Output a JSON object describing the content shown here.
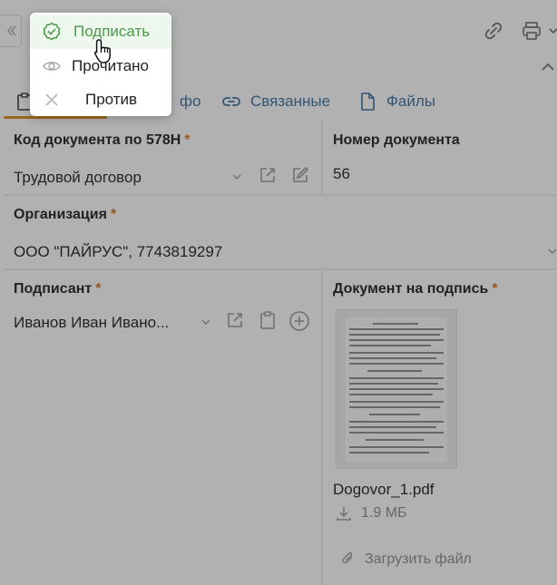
{
  "menu": {
    "items": [
      {
        "label": "Подписать",
        "icon": "check-circle-icon",
        "color": "#4a9a4a"
      },
      {
        "label": "Прочитано",
        "icon": "eye-icon",
        "color": "#222222"
      },
      {
        "label": "Против",
        "icon": "close-icon",
        "color": "#222222"
      }
    ]
  },
  "tabs": [
    {
      "label": "фо",
      "icon": "clipboard-icon"
    },
    {
      "label": "Связанные",
      "icon": "link-icon"
    },
    {
      "label": "Файлы",
      "icon": "file-icon"
    }
  ],
  "fields": {
    "doc_code": {
      "label": "Код документа по 578Н",
      "required": "*",
      "value": "Трудовой договор"
    },
    "doc_number": {
      "label": "Номер документа",
      "value": "56"
    },
    "organization": {
      "label": "Организация",
      "required": "*",
      "value": "ООО \"ПАЙРУС\", 7743819297"
    },
    "signer": {
      "label": "Подписант",
      "required": "*",
      "value": "Иванов Иван Ивано..."
    },
    "sign_doc": {
      "label": "Документ на подпись",
      "required": "*"
    }
  },
  "file": {
    "name": "Dogovor_1.pdf",
    "size": "1.9 МБ",
    "upload_label": "Загрузить файл"
  },
  "colors": {
    "accent_orange": "#e08a18",
    "link_blue": "#3b6fa0",
    "success_green": "#4a9a4a",
    "required_red": "#d9731d"
  }
}
